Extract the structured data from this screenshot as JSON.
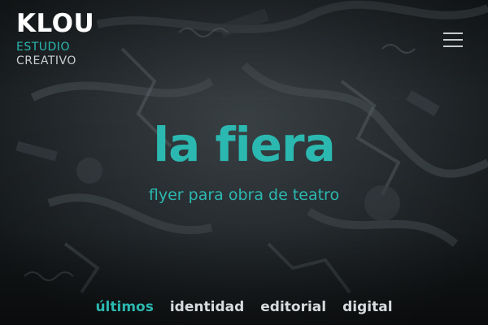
{
  "brand": {
    "name": "KLOU",
    "tagline_line1": "ESTUDIO",
    "tagline_line2": "CREATIVO"
  },
  "menu": {
    "icon": "hamburger-menu-icon"
  },
  "hero": {
    "title": "la fiera",
    "subtitle": "flyer para obra de teatro"
  },
  "nav": {
    "tabs": [
      {
        "label": "últimos",
        "active": true
      },
      {
        "label": "identidad",
        "active": false
      },
      {
        "label": "editorial",
        "active": false
      },
      {
        "label": "digital",
        "active": false
      }
    ]
  },
  "colors": {
    "accent": "#2bb8b0",
    "text_light": "#d8dbdd",
    "background": "#1c2124"
  }
}
